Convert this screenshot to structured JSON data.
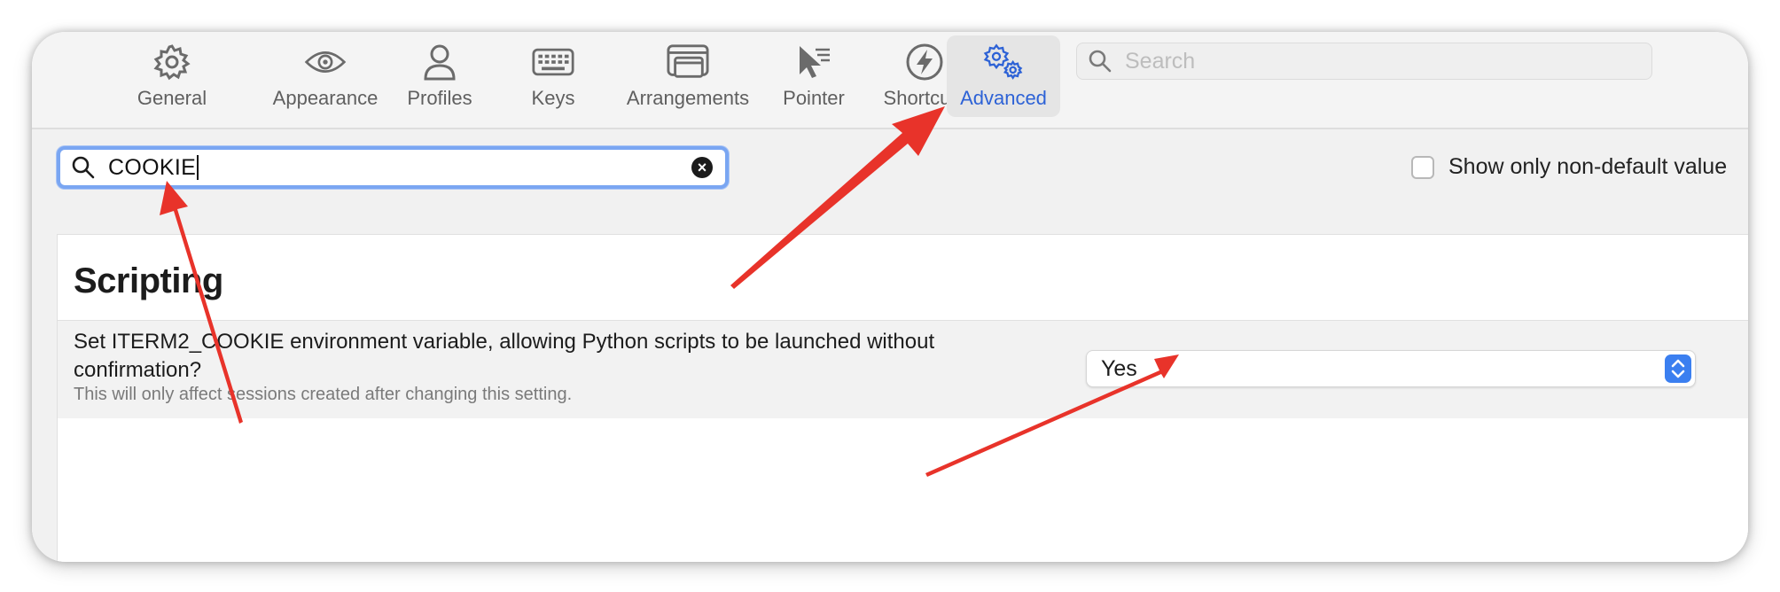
{
  "toolbar": {
    "tabs": [
      {
        "label": "General",
        "icon": "gear-icon"
      },
      {
        "label": "Appearance",
        "icon": "eye-icon"
      },
      {
        "label": "Profiles",
        "icon": "person-icon"
      },
      {
        "label": "Keys",
        "icon": "keyboard-icon"
      },
      {
        "label": "Arrangements",
        "icon": "windows-icon"
      },
      {
        "label": "Pointer",
        "icon": "cursor-icon"
      },
      {
        "label": "Shortcuts",
        "icon": "lightning-icon"
      },
      {
        "label": "Advanced",
        "icon": "gears-icon"
      }
    ],
    "selected_tab": "Advanced",
    "search": {
      "placeholder": "Search",
      "value": ""
    }
  },
  "filter": {
    "value": "COOKIE",
    "show_only_non_default_label": "Show only non-default value",
    "show_only_non_default_checked": false
  },
  "settings": {
    "section_title": "Scripting",
    "rows": [
      {
        "label": "Set ITERM2_COOKIE environment variable, allowing Python scripts to be launched without confirmation?",
        "hint": "This will only affect sessions created after changing this setting.",
        "value": "Yes"
      }
    ]
  },
  "colors": {
    "accent": "#2d62d6",
    "annotation_arrow": "#e8332a",
    "stepper": "#3b7ff0"
  }
}
